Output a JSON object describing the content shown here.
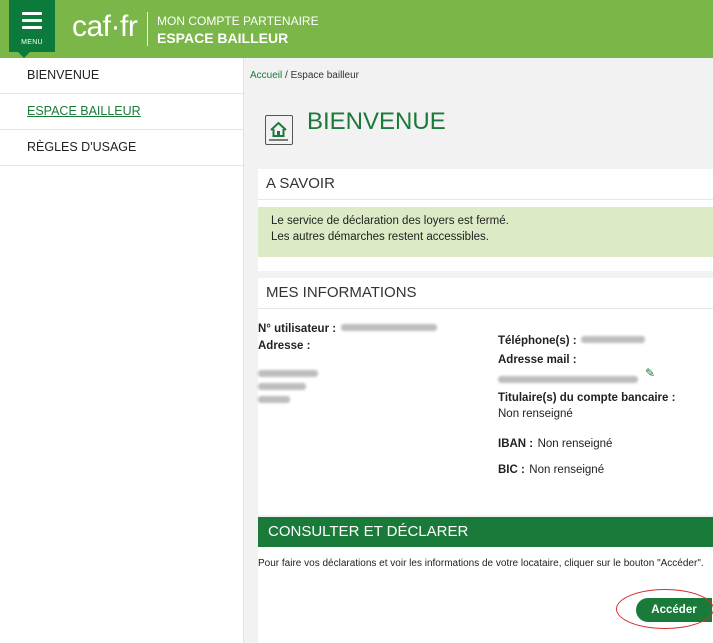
{
  "header": {
    "menu_label": "MENU",
    "logo_text": "caf·fr",
    "subtitle": "MON COMPTE PARTENAIRE",
    "title": "ESPACE BAILLEUR"
  },
  "sidebar": {
    "items": [
      {
        "label": "BIENVENUE"
      },
      {
        "label": "ESPACE BAILLEUR"
      },
      {
        "label": "RÈGLES D'USAGE"
      }
    ]
  },
  "breadcrumb": {
    "home": "Accueil",
    "separator": " / ",
    "current": "Espace bailleur"
  },
  "page_title": "BIENVENUE",
  "a_savoir": {
    "title": "A SAVOIR",
    "line1": "Le service de déclaration des loyers est fermé.",
    "line2": "Les autres démarches restent accessibles."
  },
  "mes_informations": {
    "title": "MES INFORMATIONS",
    "user_label": "N° utilisateur :",
    "address_label": "Adresse :",
    "phone_label": "Téléphone(s) :",
    "email_label": "Adresse mail :",
    "holder_label": "Titulaire(s) du compte bancaire :",
    "holder_value": "Non renseigné",
    "iban_label": "IBAN :",
    "iban_value": "Non renseigné",
    "bic_label": "BIC :",
    "bic_value": "Non renseigné"
  },
  "consulter": {
    "title": "CONSULTER ET DÉCLARER",
    "text": "Pour faire vos déclarations et voir les informations de votre locataire, cliquer sur le bouton \"Accéder\".",
    "button": "Accéder"
  },
  "colors": {
    "header_green": "#7ab648",
    "dark_green": "#1a7a3a",
    "notice_bg": "#dcebc5",
    "highlight_red": "#d32f2f"
  }
}
